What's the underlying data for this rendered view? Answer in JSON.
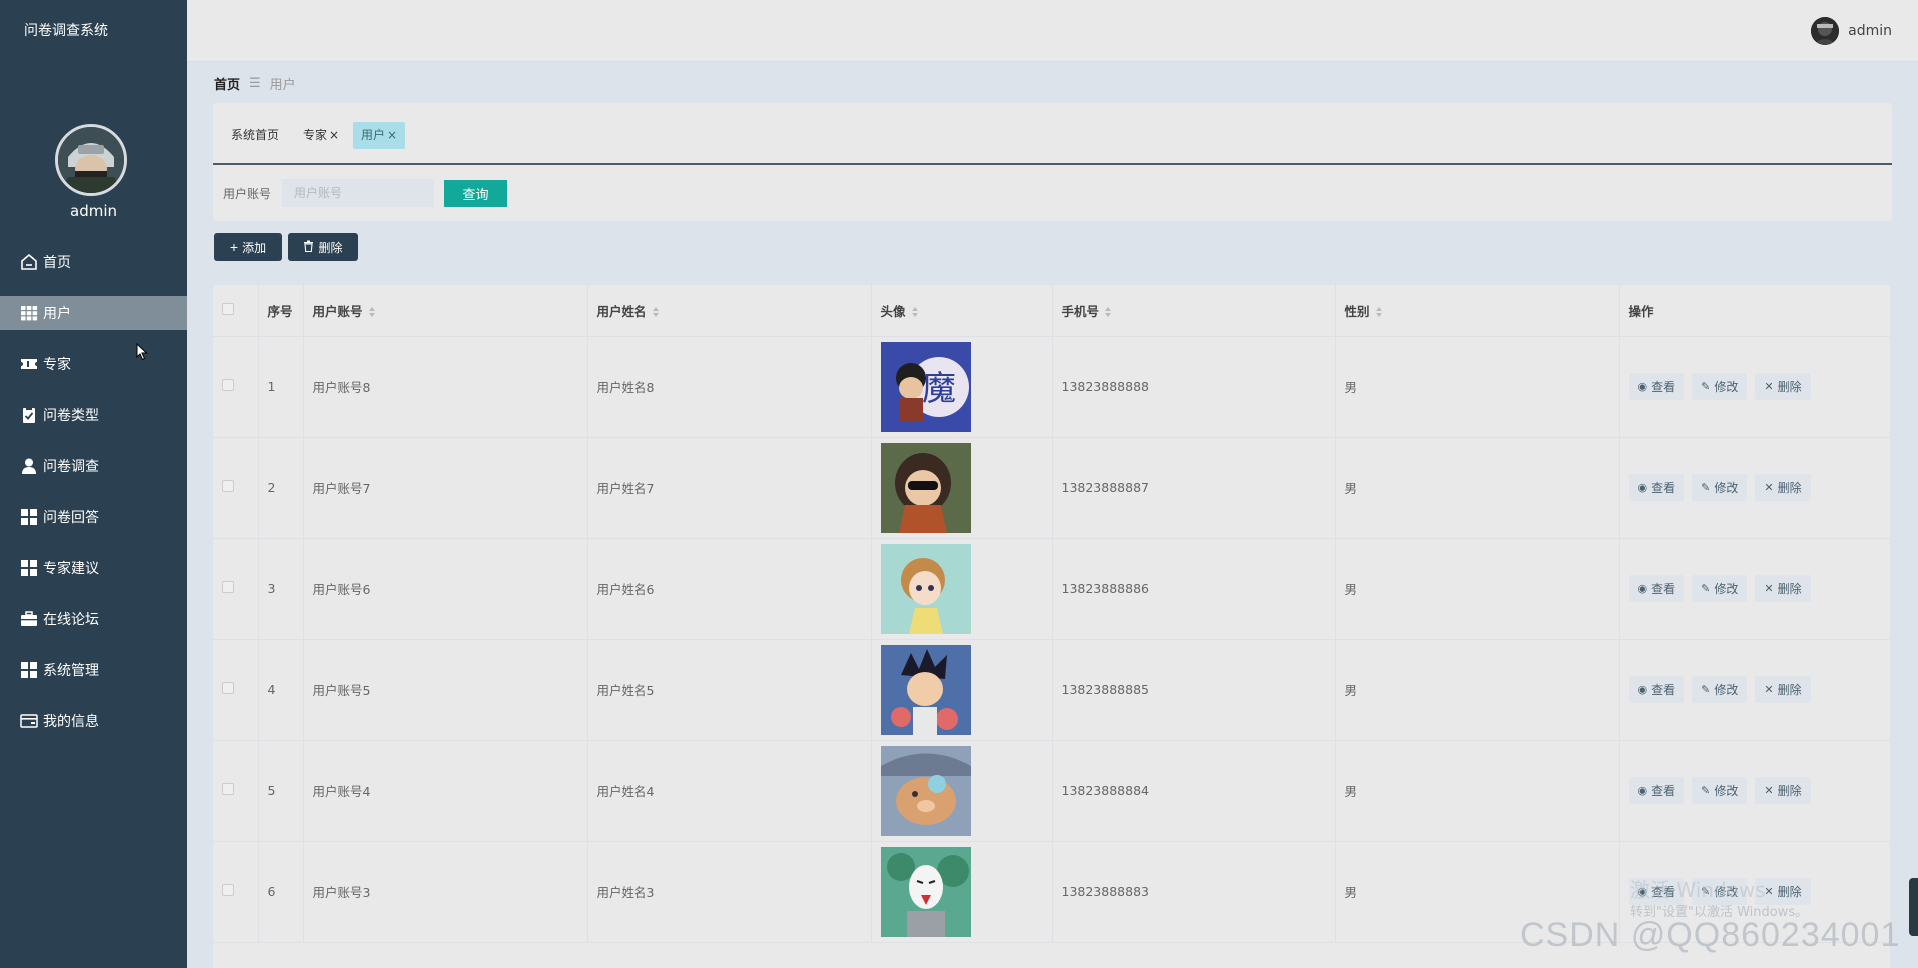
{
  "app": {
    "title": "问卷调查系统"
  },
  "sidebar": {
    "username": "admin",
    "items": [
      {
        "label": "首页",
        "icon": "home-icon"
      },
      {
        "label": "用户",
        "icon": "grid-icon",
        "active": true
      },
      {
        "label": "专家",
        "icon": "ticket-icon"
      },
      {
        "label": "问卷类型",
        "icon": "clipboard-check-icon"
      },
      {
        "label": "问卷调查",
        "icon": "person-icon"
      },
      {
        "label": "问卷回答",
        "icon": "grid-icon"
      },
      {
        "label": "专家建议",
        "icon": "grid-icon"
      },
      {
        "label": "在线论坛",
        "icon": "briefcase-icon"
      },
      {
        "label": "系统管理",
        "icon": "grid-icon"
      },
      {
        "label": "我的信息",
        "icon": "card-icon"
      }
    ]
  },
  "header": {
    "username": "admin"
  },
  "breadcrumb": {
    "home": "首页",
    "current": "用户"
  },
  "tabs": {
    "home": "系统首页",
    "expert": "专家",
    "user": "用户",
    "close": "×"
  },
  "search": {
    "label": "用户账号",
    "placeholder": "用户账号",
    "button": "查询"
  },
  "actions": {
    "add": "添加",
    "delete": "删除"
  },
  "table": {
    "headers": {
      "index": "序号",
      "account": "用户账号",
      "name": "用户姓名",
      "avatar": "头像",
      "phone": "手机号",
      "gender": "性别",
      "ops": "操作"
    },
    "op_labels": {
      "view": "查看",
      "edit": "修改",
      "delete": "删除"
    },
    "rows": [
      {
        "index": "1",
        "account": "用户账号8",
        "name": "用户姓名8",
        "phone": "13823888888",
        "gender": "男"
      },
      {
        "index": "2",
        "account": "用户账号7",
        "name": "用户姓名7",
        "phone": "13823888887",
        "gender": "男"
      },
      {
        "index": "3",
        "account": "用户账号6",
        "name": "用户姓名6",
        "phone": "13823888886",
        "gender": "男"
      },
      {
        "index": "4",
        "account": "用户账号5",
        "name": "用户姓名5",
        "phone": "13823888885",
        "gender": "男"
      },
      {
        "index": "5",
        "account": "用户账号4",
        "name": "用户姓名4",
        "phone": "13823888884",
        "gender": "男"
      },
      {
        "index": "6",
        "account": "用户账号3",
        "name": "用户姓名3",
        "phone": "13823888883",
        "gender": "男"
      }
    ]
  },
  "watermark": {
    "activate": "激活 Windows",
    "hint": "转到\"设置\"以激活 Windows。",
    "csdn": "CSDN @QQ860234001"
  },
  "colors": {
    "sidebar": "#2b4050",
    "accent": "#12a99b",
    "tab_active": "#a9dde8"
  }
}
